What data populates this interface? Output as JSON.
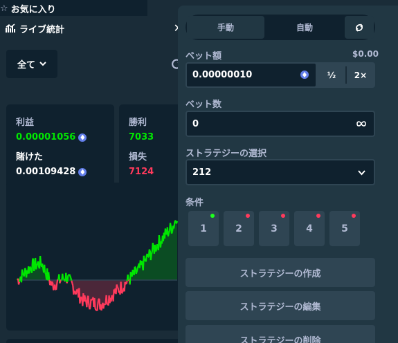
{
  "sidebar": {
    "favorites_label": "お気に入り"
  },
  "stats": {
    "title": "ライブ統計",
    "filter_value": "全て",
    "profit_label": "利益",
    "profit_value": "0.00001056",
    "wagered_label": "賭けた",
    "wagered_value": "0.00109428",
    "wins_label": "勝利",
    "wins_value": "7033",
    "losses_label": "損失",
    "losses_value": "7124"
  },
  "game": {
    "tabs": {
      "manual": "手動",
      "auto": "自動"
    },
    "bet_amount_label": "ベット額",
    "bet_amount_usd": "$0.00",
    "bet_amount_value": "0.00000010",
    "half_label": "½",
    "double_label": "2×",
    "bet_count_label": "ベット数",
    "bet_count_value": "0",
    "strategy_label": "ストラテジーの選択",
    "strategy_value": "212",
    "conditions_label": "条件",
    "conditions": [
      {
        "label": "1",
        "status_color": "#1fff20"
      },
      {
        "label": "2",
        "status_color": "#ff3a5c"
      },
      {
        "label": "3",
        "status_color": "#ff3a5c"
      },
      {
        "label": "4",
        "status_color": "#ff3a5c"
      },
      {
        "label": "5",
        "status_color": "#ff3a5c"
      }
    ],
    "create_strategy": "ストラテジーの作成",
    "edit_strategy": "ストラテジーの編集",
    "delete_strategy": "ストラテジーの削除"
  },
  "colors": {
    "profit": "#00e701",
    "loss": "#ff3a5c",
    "panel": "#0f212e"
  },
  "icons": [
    "star-icon",
    "chart-icon",
    "close-icon",
    "chevron-down-icon",
    "refresh-icon",
    "eth-icon",
    "swap-icon",
    "infinity-icon"
  ]
}
